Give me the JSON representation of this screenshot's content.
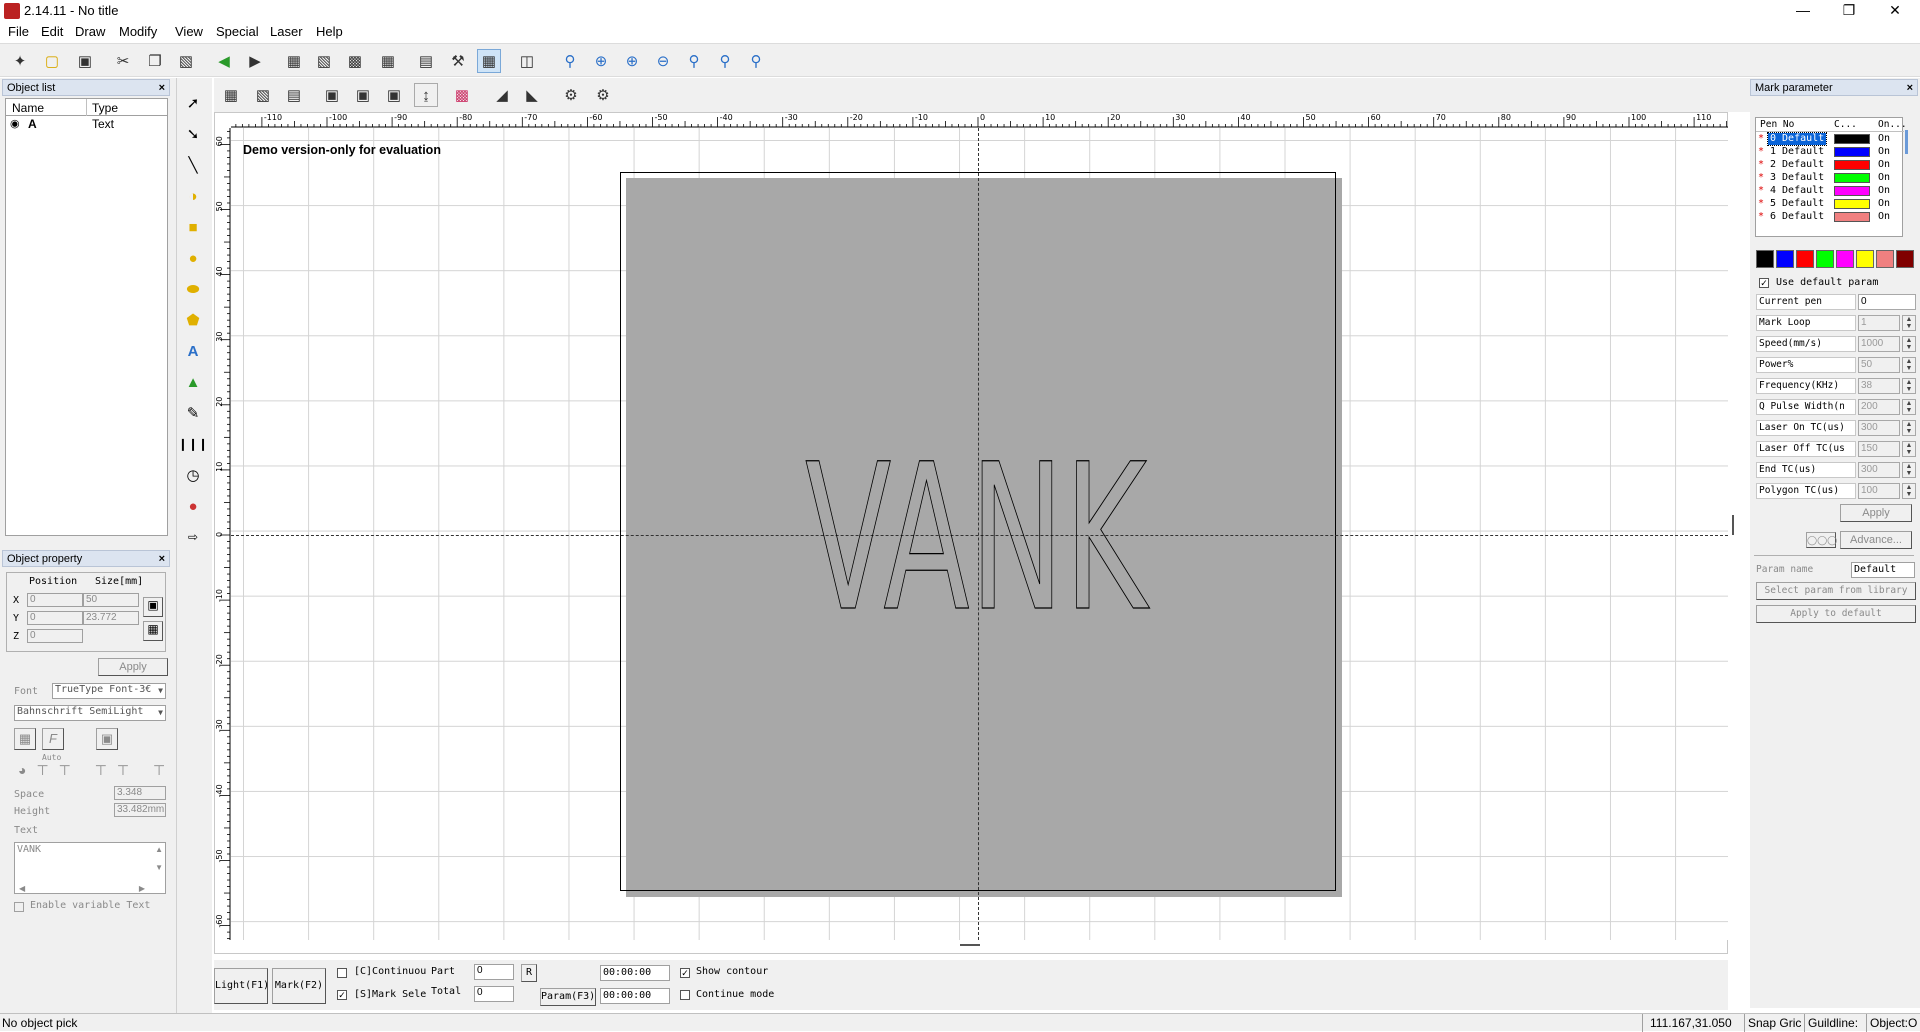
{
  "window": {
    "title": "2.14.11 - No title",
    "app_icon_text": "EZCAD"
  },
  "menu": [
    "File",
    "Edit",
    "Draw",
    "Modify",
    "View",
    "Special",
    "Laser",
    "Help"
  ],
  "object_list": {
    "title": "Object list",
    "columns": [
      "Name",
      "Type"
    ],
    "rows": [
      {
        "name": "A",
        "type": "Text"
      }
    ]
  },
  "object_property": {
    "title": "Object property",
    "position_label": "Position",
    "size_label": "Size[mm]",
    "x_label": "X",
    "y_label": "Y",
    "z_label": "Z",
    "x_pos": "0",
    "x_size": "50",
    "y_pos": "0",
    "y_size": "23.772",
    "z_pos": "0",
    "apply": "Apply",
    "font_label": "Font",
    "font_type": "TrueType Font-3€",
    "font_name": "Bahnschrift SemiLight",
    "auto_label": "Auto",
    "space_label": "Space",
    "space_value": "3.348",
    "height_label": "Height",
    "height_value": "33.482mm",
    "text_label": "Text",
    "text_value": "VANK",
    "enable_variable": "Enable variable Text"
  },
  "canvas": {
    "demo_text": "Demo version-only for evaluation",
    "object_text": "VANK",
    "x_ruler": [
      "-110",
      "-100",
      "-90",
      "-80",
      "-70",
      "-60",
      "-50",
      "-40",
      "-30",
      "-20",
      "-10",
      "0",
      "10",
      "20",
      "30",
      "40",
      "50",
      "60",
      "70",
      "80",
      "90",
      "100",
      "110"
    ],
    "y_ruler": [
      "60",
      "50",
      "40",
      "30",
      "20",
      "10",
      "0",
      "-10",
      "-20",
      "-30",
      "-40",
      "-50",
      "-60"
    ]
  },
  "mark_parameter": {
    "title": "Mark parameter",
    "columns": [
      "Pen No",
      "C...",
      "On..."
    ],
    "pens": [
      {
        "no": "0 Default",
        "color": "#000000",
        "on": "On"
      },
      {
        "no": "1 Default",
        "color": "#0000ff",
        "on": "On"
      },
      {
        "no": "2 Default",
        "color": "#ff0000",
        "on": "On"
      },
      {
        "no": "3 Default",
        "color": "#00ff00",
        "on": "On"
      },
      {
        "no": "4 Default",
        "color": "#ff00ff",
        "on": "On"
      },
      {
        "no": "5 Default",
        "color": "#ffff00",
        "on": "On"
      },
      {
        "no": "6 Default",
        "color": "#f08080",
        "on": "On"
      }
    ],
    "palette": [
      "#000000",
      "#0000ff",
      "#ff0000",
      "#00ff00",
      "#ff00ff",
      "#ffff00",
      "#f08080",
      "#800000"
    ],
    "use_default": "Use default param",
    "params": [
      {
        "label": "Current pen",
        "value": "0",
        "spin": false
      },
      {
        "label": "Mark Loop",
        "value": "1",
        "spin": true
      },
      {
        "label": "Speed(mm/s)",
        "value": "1000",
        "spin": true
      },
      {
        "label": "Power%",
        "value": "50",
        "spin": true
      },
      {
        "label": "Frequency(KHz)",
        "value": "38",
        "spin": true
      },
      {
        "label": "Q Pulse Width(n",
        "value": "200",
        "spin": true
      },
      {
        "label": "Laser On TC(us)",
        "value": "300",
        "spin": true
      },
      {
        "label": "Laser Off TC(us",
        "value": "150",
        "spin": true
      },
      {
        "label": "End TC(us)",
        "value": "300",
        "spin": true
      },
      {
        "label": "Polygon TC(us)",
        "value": "100",
        "spin": true
      }
    ],
    "apply": "Apply",
    "advance": "Advance...",
    "param_name_label": "Param name",
    "param_name_value": "Default",
    "select_from_library": "Select param from library",
    "apply_to_default": "Apply to default"
  },
  "bottom": {
    "light": "Light(F1)",
    "mark": "Mark(F2)",
    "continuous": "[C]Continuou",
    "part_label": "Part",
    "part_value": "0",
    "r_button": "R",
    "mark_sel": "[S]Mark Sele",
    "total_label": "Total",
    "total_value": "0",
    "param": "Param(F3)",
    "time1": "00:00:00",
    "time2": "00:00:00",
    "show_contour": "Show contour",
    "continue_mode": "Continue mode"
  },
  "status": {
    "left": "No object pick",
    "coords": "111.167,31.050",
    "snap": "Snap Gric",
    "guideline": "Guildline:",
    "object": "Object:O"
  }
}
